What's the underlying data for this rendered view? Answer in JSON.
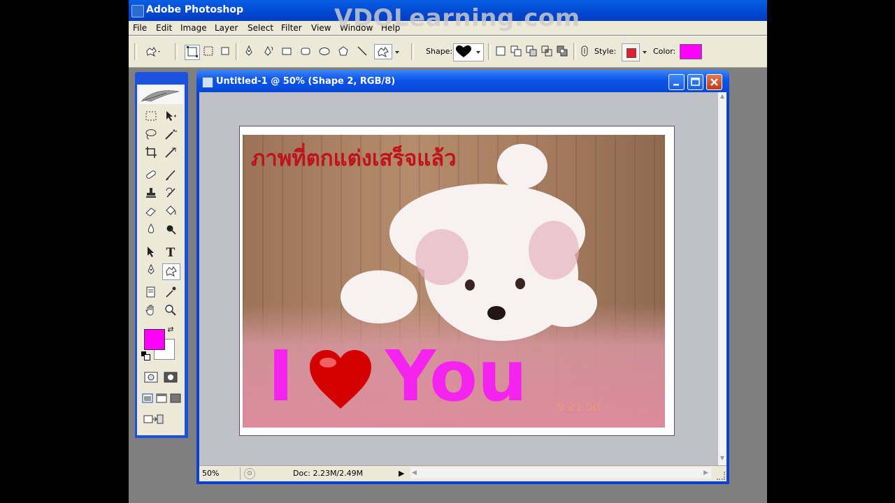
{
  "watermark": "VDOLearning.com",
  "app": {
    "title": "Adobe Photoshop"
  },
  "menu": [
    "File",
    "Edit",
    "Image",
    "Layer",
    "Select",
    "Filter",
    "View",
    "Window",
    "Help"
  ],
  "options": {
    "shape_label": "Shape:",
    "style_label": "Style:",
    "color_label": "Color:",
    "color": "#ff00ff",
    "style_color": "#e0202a"
  },
  "document": {
    "title": "Untitled-1 @ 50% (Shape 2, RGB/8)",
    "zoom": "50%",
    "doc_info": "Doc: 2.23M/2.49M"
  },
  "canvas": {
    "thai_text": "ภาพที่ตกแต่งเสร็จแล้ว",
    "love_i": "I",
    "love_you": "You",
    "date_stamp": "9 21 50",
    "text_color": "#f423f0",
    "heart_color": "#d40000"
  },
  "toolbox": {
    "foreground_color": "#ff00ff",
    "background_color": "#ffffff"
  }
}
